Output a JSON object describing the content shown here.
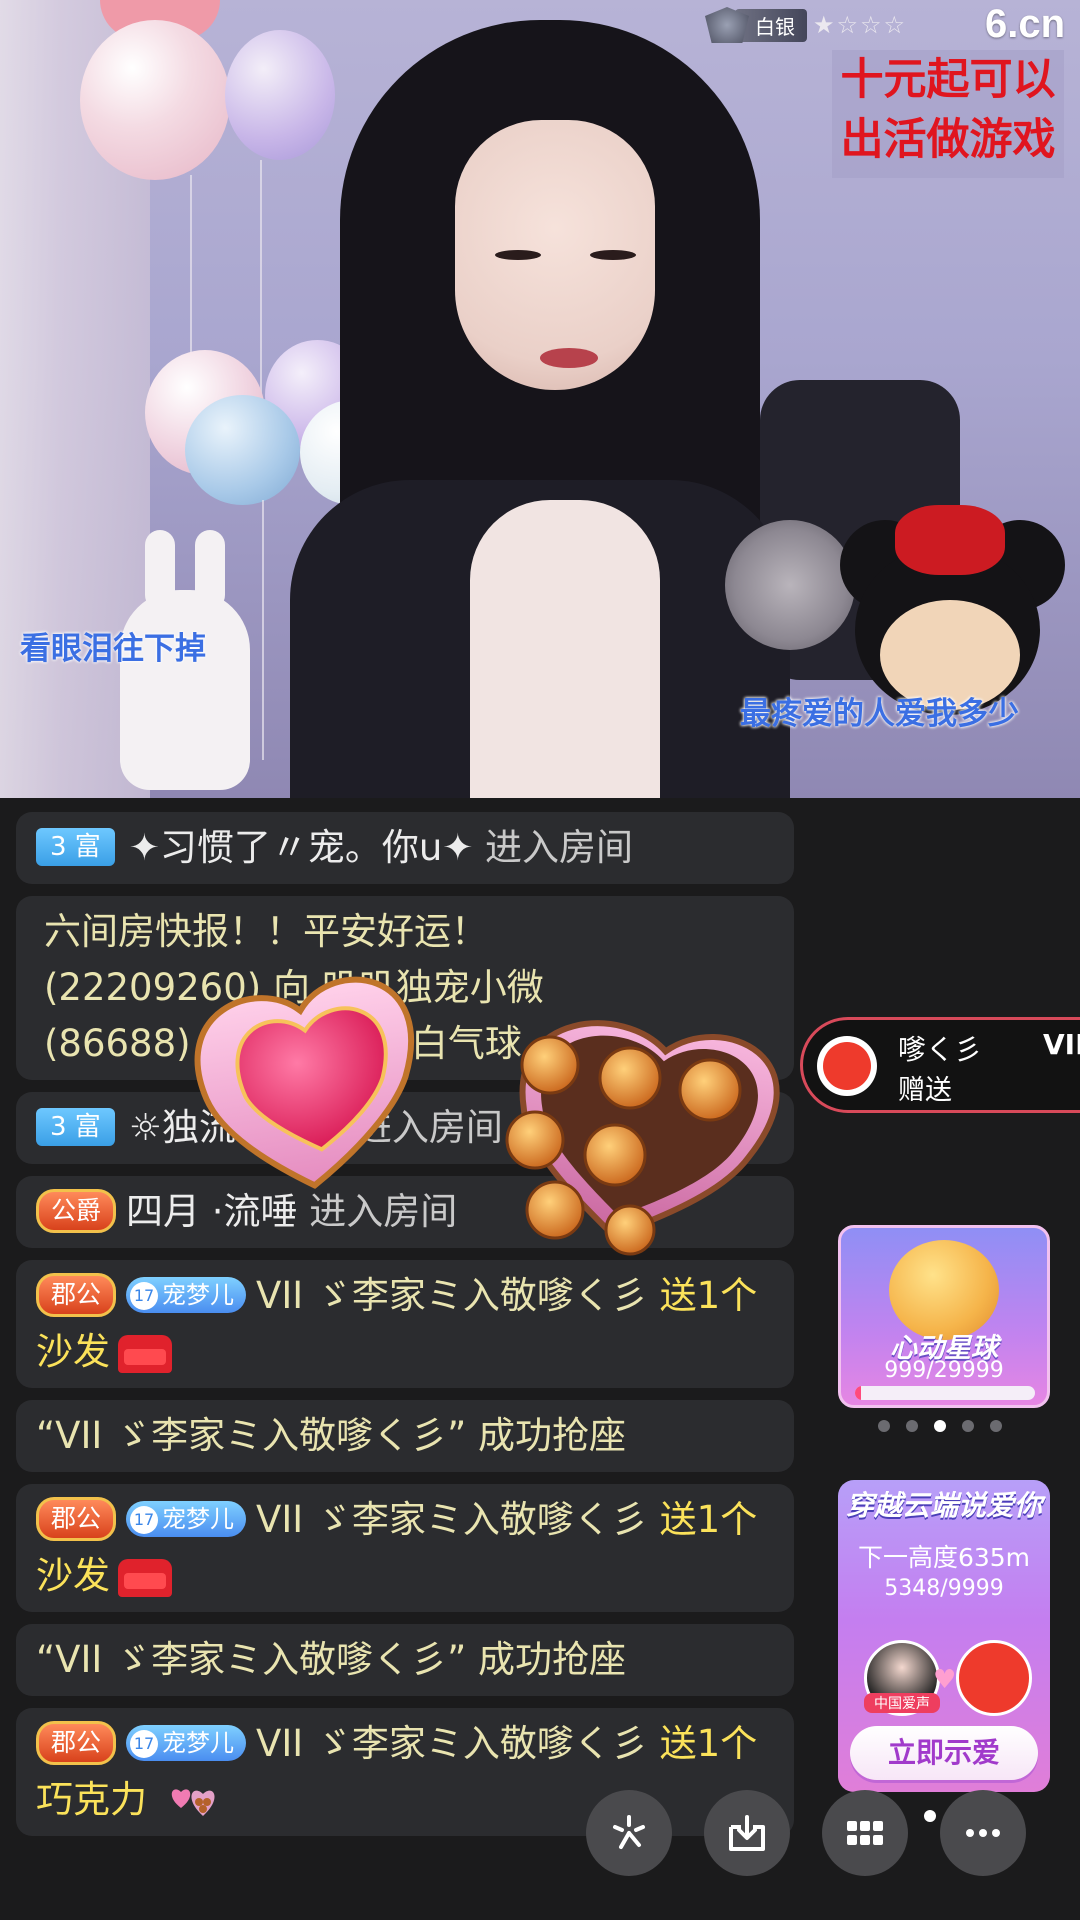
{
  "stream": {
    "rank_label": "白银",
    "stars": "★☆☆☆",
    "site_logo": "6.cn",
    "promo_line1": "十元起可以",
    "promo_line2": "出活做游戏",
    "caption_left": "看眼泪往下掉",
    "caption_right": "最疼爱的人爱我多少"
  },
  "chat": {
    "m1": {
      "level": "3 富",
      "user": "✦习惯了〃宠。你u✦",
      "action": " 进入房间"
    },
    "m2": {
      "line1": "六间房快报！！平安好运！",
      "line2": "(22209260)  向  叽叽独宠小微",
      "line3": "(86688) 赠送了1个告白气球"
    },
    "m3": {
      "level": "3 富",
      "user": "☼独流若苗☼",
      "action": " 进入房间"
    },
    "m4": {
      "noble": "公爵",
      "user": "四月  ·流唾",
      "action": " 进入房间"
    },
    "m5": {
      "noble": "郡公",
      "fan_level": "17",
      "fan_name": "宠梦儿",
      "user": "VII ゞ李家ミ入敬嗲く彡",
      "gift_text": " 送1个",
      "gift_name": "沙发"
    },
    "m6": {
      "text": "“VII ゞ李家ミ入敬嗲く彡” 成功抢座"
    },
    "m7": {
      "noble": "郡公",
      "fan_level": "17",
      "fan_name": "宠梦儿",
      "user": "VII ゞ李家ミ入敬嗲く彡",
      "gift_text": " 送1个",
      "gift_name": "沙发"
    },
    "m8": {
      "text": "“VII ゞ李家ミ入敬嗲く彡” 成功抢座"
    },
    "m9": {
      "noble": "郡公",
      "fan_level": "17",
      "fan_name": "宠梦儿",
      "user": "VII ゞ李家ミ入敬嗲く彡",
      "gift_text": " 送1个",
      "gift_name": "巧克力"
    }
  },
  "gift_notice": {
    "user": "嗲く彡",
    "action": "赠送",
    "vip": "VII"
  },
  "card_star": {
    "title": "心动星球",
    "progress_text": "999/29999",
    "progress": 0.033
  },
  "card_cloud": {
    "title": "穿越云端说爱你",
    "next_height": "下一高度635m",
    "progress_text": "5348/9999",
    "avatar_label": "中国爱声",
    "button": "立即示爱"
  },
  "colors": {
    "chat_bg": "#2b2c2f",
    "gift_yellow": "#fbe25a",
    "level_blue": "#3a9fe6",
    "accent_red": "#ee3a2c"
  },
  "icons": [
    "sparkle-icon",
    "download-icon",
    "grid-icon",
    "more-icon"
  ]
}
